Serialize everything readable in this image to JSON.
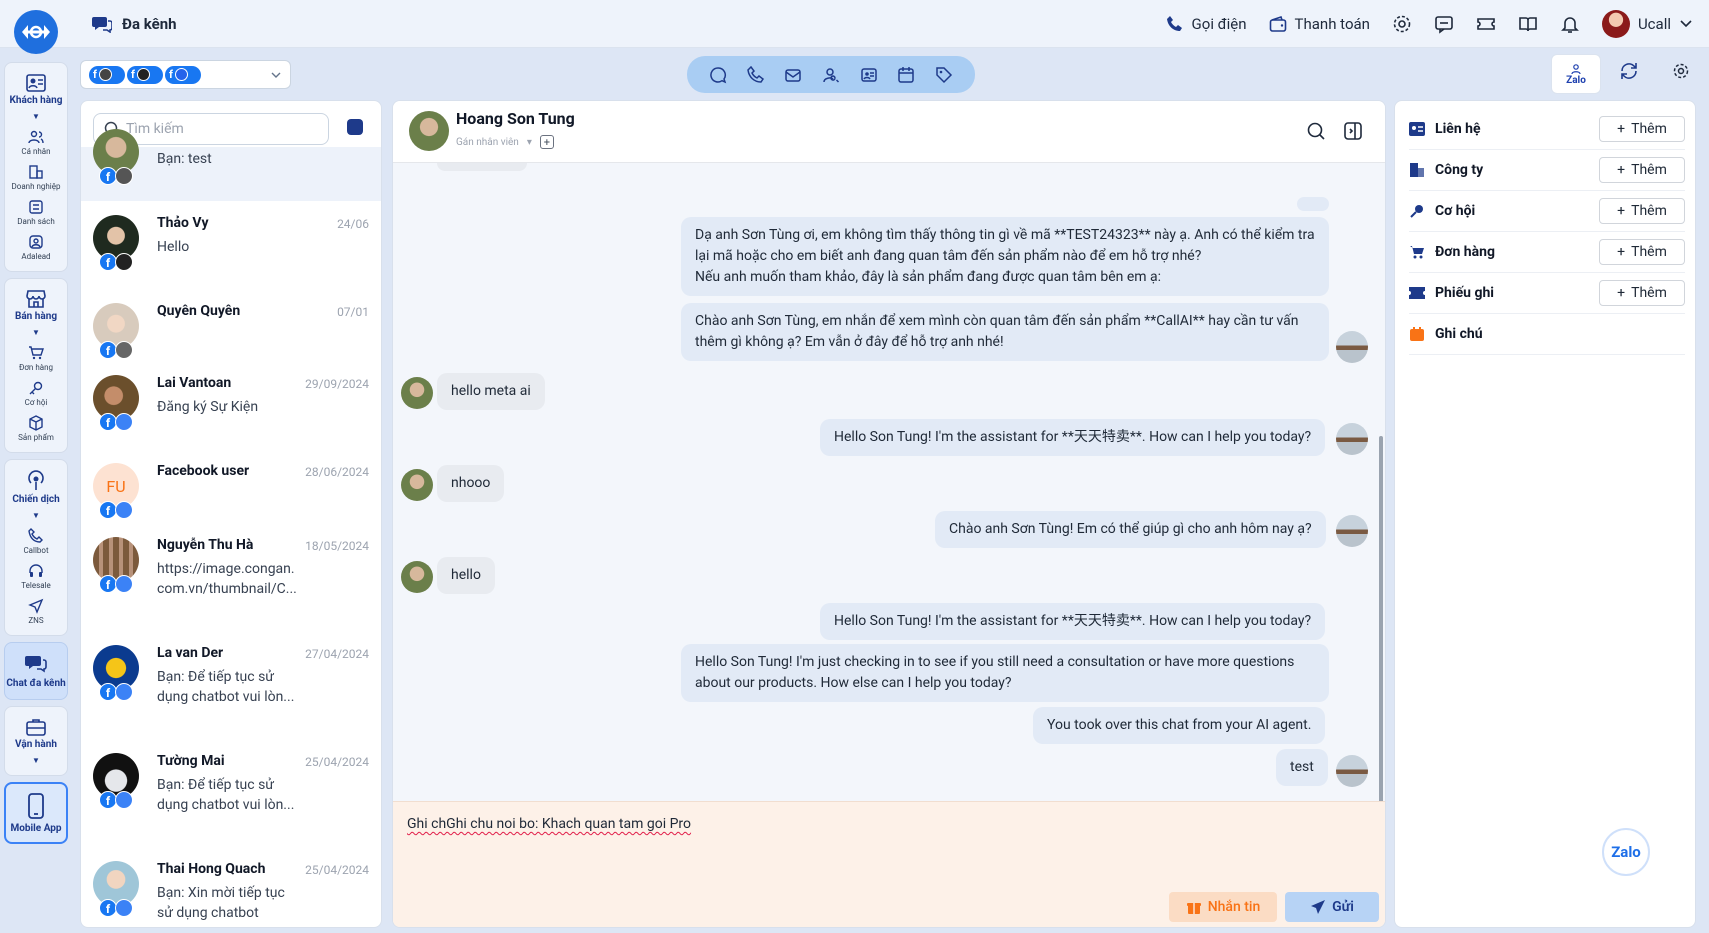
{
  "header": {
    "title": "Đa kênh",
    "call_label": "Gọi điện",
    "payment_label": "Thanh toán",
    "user_name": "Ucall"
  },
  "rail": {
    "customers": "Khách hàng",
    "personal": "Cá nhân",
    "business": "Doanh nghiệp",
    "list": "Danh sách",
    "adalead": "Adalead",
    "sales": "Bán hàng",
    "orders": "Đơn hàng",
    "opportunity": "Cơ hội",
    "products": "Sản phẩm",
    "campaign": "Chiến dịch",
    "callbot": "Callbot",
    "telesale": "Telesale",
    "zns": "ZNS",
    "chat": "Chat đa kênh",
    "operation": "Vận hành",
    "mobile": "Mobile App"
  },
  "zalo_tab": "Zalo",
  "search": {
    "placeholder": "Tìm kiếm"
  },
  "conversations": [
    {
      "name": "",
      "date": "",
      "message": "Bạn: test"
    },
    {
      "name": "Thảo Vy",
      "date": "24/06",
      "message": "Hello"
    },
    {
      "name": "Quyên Quyên",
      "date": "07/01",
      "message": ""
    },
    {
      "name": "Lai Vantoan",
      "date": "29/09/2024",
      "message": "Đăng ký Sự Kiện"
    },
    {
      "name": "Facebook user",
      "date": "28/06/2024",
      "message": "",
      "initials": "FU"
    },
    {
      "name": "Nguyễn Thu Hà",
      "date": "18/05/2024",
      "message": "https://image.congan.\ncom.vn/thumbnail/C..."
    },
    {
      "name": "La van Der",
      "date": "27/04/2024",
      "message": "Bạn: Để tiếp tục sử\ndụng chatbot vui lòn..."
    },
    {
      "name": "Tường Mai",
      "date": "25/04/2024",
      "message": "Bạn: Để tiếp tục sử\ndụng chatbot vui lòn..."
    },
    {
      "name": "Thai Hong Quach",
      "date": "25/04/2024",
      "message": "Bạn: Xin mời tiếp tục\nsử dụng chatbot"
    }
  ],
  "chat": {
    "contact_name": "Hoang Son Tung",
    "assign_label": "Gán nhân viên",
    "messages": [
      {
        "dir": "out",
        "text": "Dạ anh Sơn Tùng ơi, em không tìm thấy thông tin gì về mã **TEST24323** này ạ. Anh có thể kiểm tra lại mã hoặc cho em biết anh đang quan tâm đến sản phẩm nào để em hỗ trợ nhé?\nNếu anh muốn tham khảo, đây là sản phẩm đang được quan tâm bên em ạ:"
      },
      {
        "dir": "out",
        "text": "Chào anh Sơn Tùng, em nhắn để xem mình còn quan tâm đến sản phẩm **CallAI** hay cần tư vấn thêm gì không ạ? Em vẫn ở đây để hỗ trợ anh nhé!"
      },
      {
        "dir": "in",
        "text": "hello meta ai"
      },
      {
        "dir": "out",
        "text": "Hello Son Tung! I'm the assistant for **天天特卖**. How can I help you today?"
      },
      {
        "dir": "in",
        "text": "nhooo"
      },
      {
        "dir": "out",
        "text": "Chào anh Sơn Tùng! Em có thể giúp gì cho anh hôm nay ạ?"
      },
      {
        "dir": "in",
        "text": "hello"
      },
      {
        "dir": "out",
        "text": "Hello Son Tung! I'm the assistant for **天天特卖**. How can I help you today?"
      },
      {
        "dir": "out",
        "text": "Hello Son Tung! I'm just checking in to see if you still need a consultation or have more questions about our products. How else can I help you today?"
      },
      {
        "dir": "out",
        "text": "You took over this chat from your AI agent."
      },
      {
        "dir": "out",
        "text": "test"
      }
    ],
    "input_value": "Ghi chGhi chu noi bo: Khach quan tam goi Pro",
    "note_button": "Nhắn tin",
    "send_button": "Gửi"
  },
  "info": {
    "rows": [
      {
        "label": "Liên hệ",
        "action": "Thêm"
      },
      {
        "label": "Công ty",
        "action": "Thêm"
      },
      {
        "label": "Cơ hội",
        "action": "Thêm"
      },
      {
        "label": "Đơn hàng",
        "action": "Thêm"
      },
      {
        "label": "Phiếu ghi",
        "action": "Thêm"
      },
      {
        "label": "Ghi chú",
        "action": ""
      }
    ]
  },
  "zalo_widget": "Zalo",
  "colors": {
    "accent": "#1e3a8a",
    "facebook": "#1877f2",
    "note": "#f97316"
  }
}
